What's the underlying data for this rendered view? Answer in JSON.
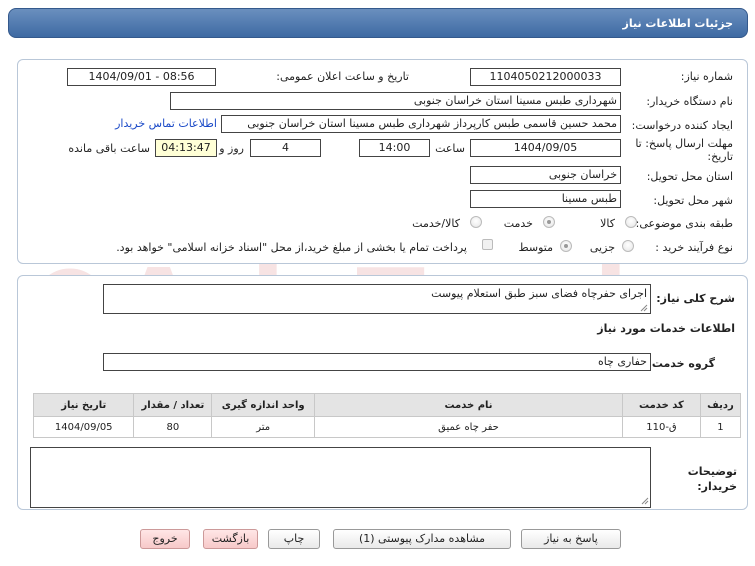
{
  "header": {
    "title": "جزئیات اطلاعات نیاز"
  },
  "form": {
    "need_number_label": "شماره نیاز:",
    "need_number": "1104050212000033",
    "announce_label": "تاریخ و ساعت اعلان عمومی:",
    "announce_value": "1404/09/01 - 08:56",
    "buyer_org_label": "نام دستگاه خریدار:",
    "buyer_org": "شهرداری طبس مسینا استان خراسان جنوبی",
    "creator_label": "ایجاد کننده درخواست:",
    "creator": "محمد حسین قاسمی طبس کارپرداز شهرداری طبس مسینا استان خراسان جنوبی",
    "contact_link": "اطلاعات تماس خریدار",
    "deadline_label_1": "مهلت ارسال پاسخ: تا",
    "deadline_label_2": "تاریخ:",
    "deadline_date": "1404/09/05",
    "time_label": "ساعت",
    "deadline_time": "14:00",
    "days_value": "4",
    "days_label": "روز و",
    "remaining_time": "04:13:47",
    "remaining_label": "ساعت باقی مانده",
    "province_label": "استان محل تحویل:",
    "province": "خراسان جنوبی",
    "city_label": "شهر محل تحویل:",
    "city": "طبس مسینا",
    "category_label": "طبقه بندی موضوعی:",
    "category_options": [
      "کالا",
      "خدمت",
      "کالا/خدمت"
    ],
    "category_selected": "خدمت",
    "process_label": "نوع فرآیند خرید :",
    "process_options": [
      "جزیی",
      "متوسط"
    ],
    "process_selected": "متوسط",
    "payment_note": "پرداخت تمام یا بخشی از مبلغ خرید،از محل \"اسناد خزانه اسلامی\" خواهد بود."
  },
  "need": {
    "summary_label": "شرح کلی نیاز:",
    "summary": "اجرای حفرچاه فضای سبز طبق استعلام پیوست",
    "services_heading": "اطلاعات خدمات مورد نیاز",
    "service_group_label": "گروه خدمت:",
    "service_group": "حفاری چاه",
    "table": {
      "headers": [
        "ردیف",
        "کد خدمت",
        "نام خدمت",
        "واحد اندازه گیری",
        "تعداد / مقدار",
        "تاریخ نیاز"
      ],
      "rows": [
        [
          "1",
          "ق-110",
          "حفر چاه عمیق",
          "متر",
          "80",
          "1404/09/05"
        ]
      ]
    },
    "buyer_notes_label_1": "توضیحات",
    "buyer_notes_label_2": "خریدار:",
    "buyer_notes": ""
  },
  "buttons": {
    "reply": "پاسخ به نیاز",
    "attachments": "مشاهده مدارک پیوستی (1)",
    "print": "چاپ",
    "back": "بازگشت",
    "exit": "خروج"
  },
  "watermark": {
    "text": "AriaTender.net"
  }
}
